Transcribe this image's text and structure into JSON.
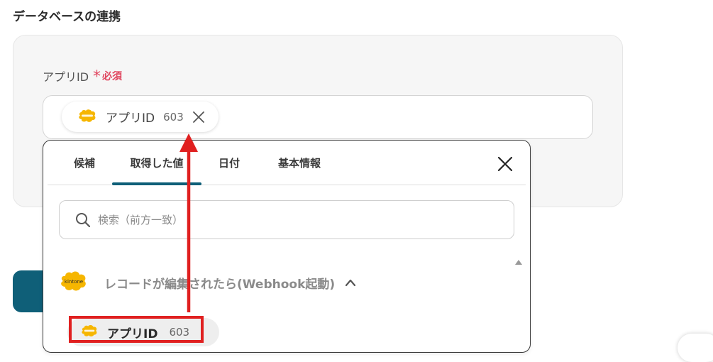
{
  "section": {
    "title": "データベースの連携"
  },
  "field": {
    "label": "アプリID",
    "required_mark": "*",
    "required_text": "必須"
  },
  "selected_chip": {
    "label": "アプリID",
    "value": "603"
  },
  "popup": {
    "tabs": [
      {
        "label": "候補",
        "active": false
      },
      {
        "label": "取得した値",
        "active": true
      },
      {
        "label": "日付",
        "active": false
      },
      {
        "label": "基本情報",
        "active": false
      }
    ],
    "search": {
      "placeholder": "検索（前方一致）",
      "value": ""
    },
    "group": {
      "title": "レコードが編集されたら(Webhook起動)",
      "logo_text": "kintone",
      "expanded": true
    },
    "items": [
      {
        "label": "アプリID",
        "value": "603"
      }
    ]
  },
  "icons": {
    "chip_logo": "kintone-logo-icon",
    "chip_remove": "close-icon",
    "popup_close": "close-icon",
    "search": "search-icon",
    "group_toggle": "chevron-up-icon"
  },
  "colors": {
    "accent": "#0f5f78",
    "required": "#e0455e",
    "highlight": "#e02020",
    "kintone": "#f6b600"
  }
}
